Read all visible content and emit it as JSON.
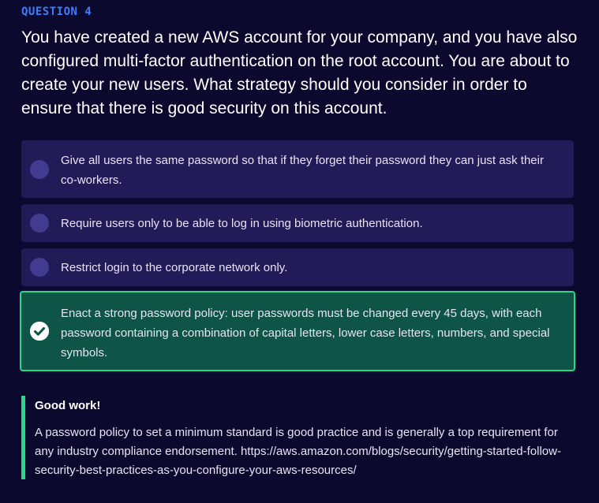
{
  "question": {
    "label": "QUESTION 4",
    "text": "You have created a new AWS account for your company, and you have also configured multi-factor authentication on the root account. You are about to create your new users. What strategy should you consider in order to ensure that there is good security on this account."
  },
  "options": [
    {
      "text": "Give all users the same password so that if they forget their password they can just ask their co-workers.",
      "selected": false
    },
    {
      "text": "Require users only to be able to log in using biometric authentication.",
      "selected": false
    },
    {
      "text": "Restrict login to the corporate network only.",
      "selected": false
    },
    {
      "text": "Enact a strong password policy: user passwords must be changed every 45 days, with each password containing a combination of capital letters, lower case letters, numbers, and special symbols.",
      "selected": true,
      "icon": "check-circle-icon"
    }
  ],
  "feedback": {
    "title": "Good work!",
    "text": "A password policy to set a minimum standard is good practice and is generally a top requirement for any industry compliance endorsement. https://aws.amazon.com/blogs/security/getting-started-follow-security-best-practices-as-you-configure-your-aws-resources/"
  },
  "colors": {
    "background": "#0b0a2e",
    "option_bg": "#211b57",
    "radio": "#433b8f",
    "correct_bg": "#0e5547",
    "correct_border": "#2bd889",
    "label_blue": "#3e7bff"
  }
}
